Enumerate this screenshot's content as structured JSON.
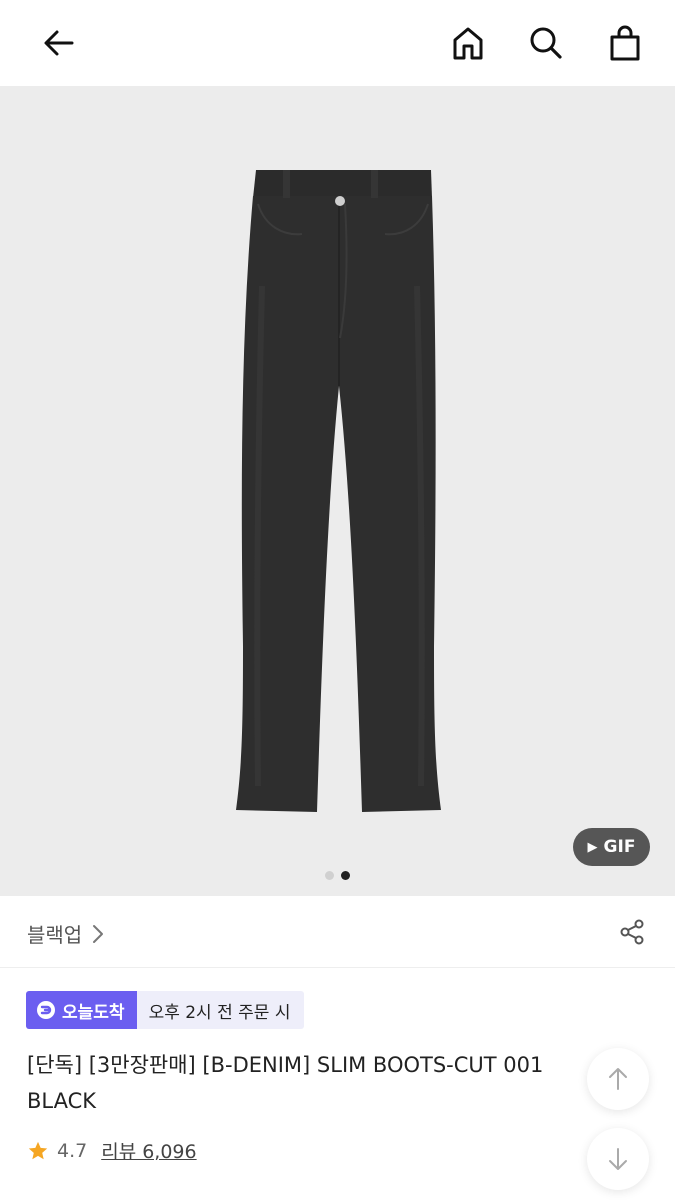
{
  "header": {
    "back_icon": "arrow-left-icon",
    "home_icon": "home-icon",
    "search_icon": "search-icon",
    "cart_icon": "shopping-bag-icon"
  },
  "gallery": {
    "gif_label": "GIF",
    "slide_count": 2,
    "active_slide": 2,
    "background_color": "#ececec"
  },
  "brand": {
    "name": "블랙업",
    "share_icon": "share-icon"
  },
  "delivery": {
    "tag_label": "오늘도착",
    "note": "오후 2시 전 주문 시",
    "tag_color": "#6b5ef0"
  },
  "product": {
    "title": "[단독] [3만장판매] [B-DENIM] SLIM BOOTS-CUT 001 BLACK",
    "rating": "4.7",
    "reviews_label": "리뷰 6,096",
    "star_color": "#f5a623"
  },
  "scroll": {
    "up_icon": "arrow-up-icon",
    "down_icon": "arrow-down-icon"
  }
}
